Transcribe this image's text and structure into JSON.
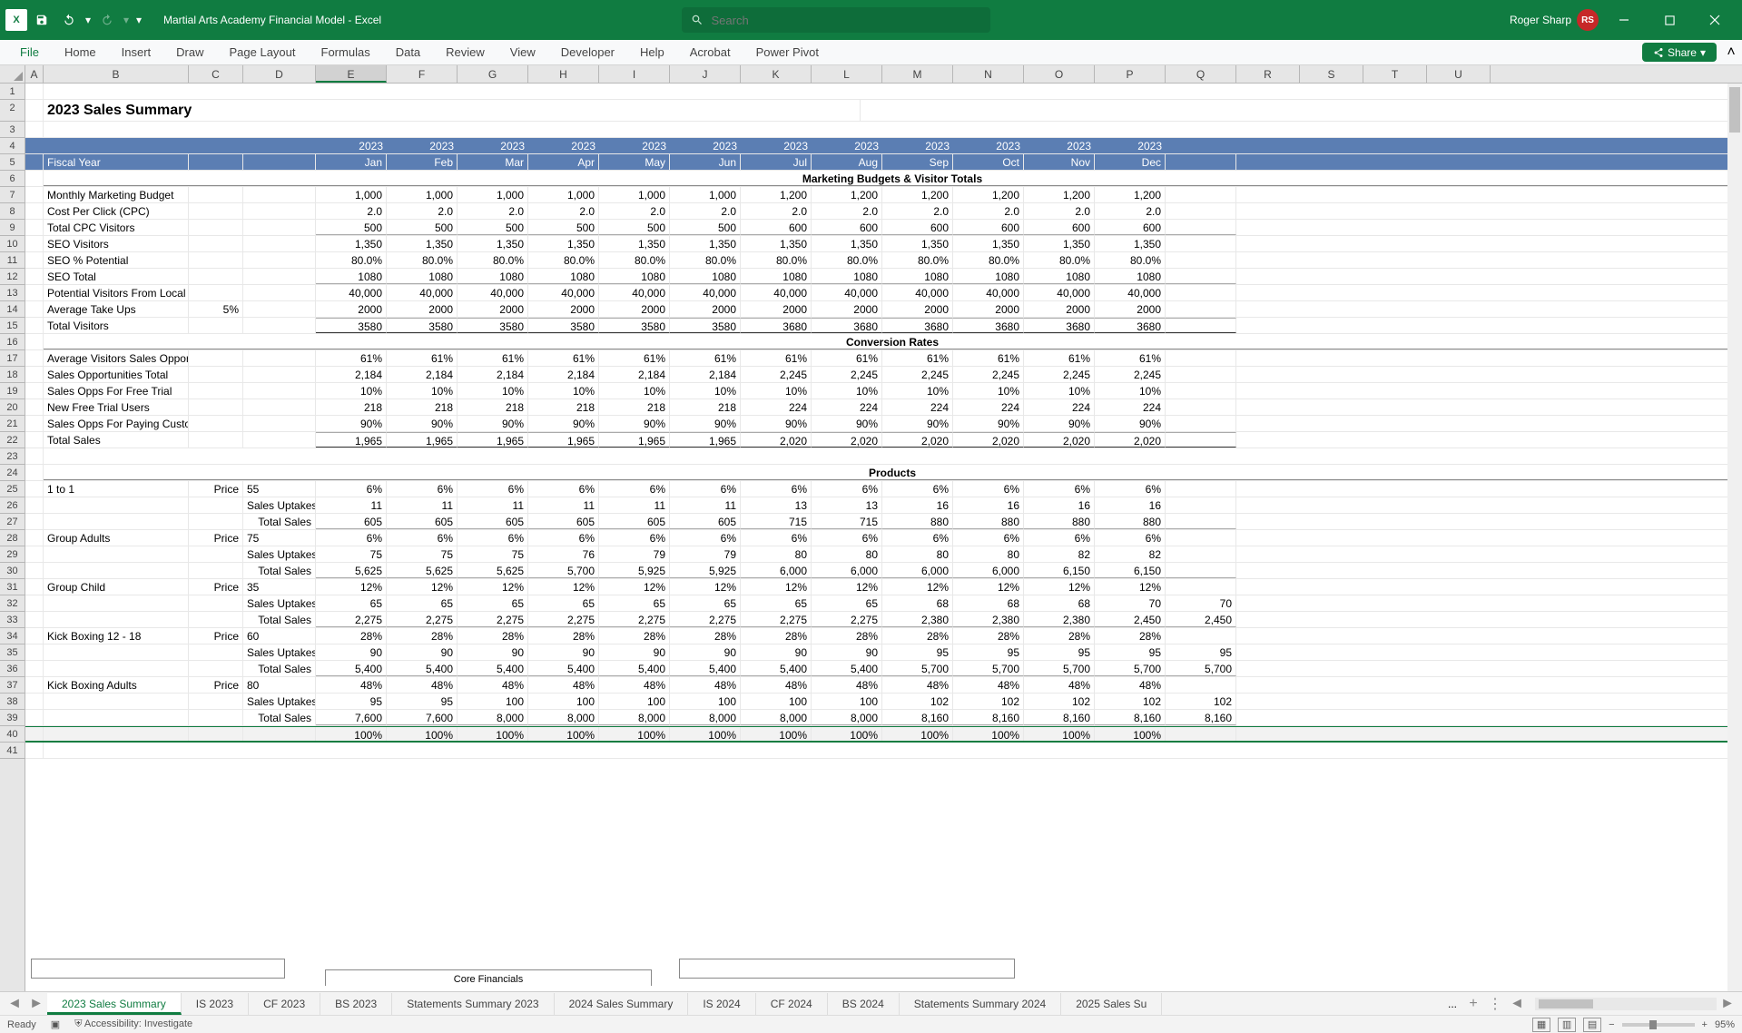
{
  "app": {
    "title": "Martial Arts Academy Financial Model  -  Excel",
    "user": "Roger Sharp",
    "initials": "RS",
    "search_placeholder": "Search"
  },
  "ribbon": [
    "File",
    "Home",
    "Insert",
    "Draw",
    "Page Layout",
    "Formulas",
    "Data",
    "Review",
    "View",
    "Developer",
    "Help",
    "Acrobat",
    "Power Pivot"
  ],
  "share_label": "Share",
  "columns": [
    "A",
    "B",
    "C",
    "D",
    "E",
    "F",
    "G",
    "H",
    "I",
    "J",
    "K",
    "L",
    "M",
    "N",
    "O",
    "P",
    "Q",
    "R",
    "S",
    "T",
    "U"
  ],
  "row_count": 41,
  "active_col": "E",
  "page_title": "2023 Sales Summary",
  "years": [
    "2023",
    "2023",
    "2023",
    "2023",
    "2023",
    "2023",
    "2023",
    "2023",
    "2023",
    "2023",
    "2023",
    "2023"
  ],
  "fiscal_year_label": "Fiscal Year",
  "months": [
    "Jan",
    "Feb",
    "Mar",
    "Apr",
    "May",
    "Jun",
    "Jul",
    "Aug",
    "Sep",
    "Oct",
    "Nov",
    "Dec"
  ],
  "sections": {
    "marketing": "Marketing Budgets & Visitor Totals",
    "conversion": "Conversion Rates",
    "products": "Products"
  },
  "rows": [
    {
      "label": "Monthly Marketing Budget",
      "vals": [
        "1,000",
        "1,000",
        "1,000",
        "1,000",
        "1,000",
        "1,000",
        "1,200",
        "1,200",
        "1,200",
        "1,200",
        "1,200",
        "1,200"
      ]
    },
    {
      "label": "Cost Per Click (CPC)",
      "vals": [
        "2.0",
        "2.0",
        "2.0",
        "2.0",
        "2.0",
        "2.0",
        "2.0",
        "2.0",
        "2.0",
        "2.0",
        "2.0",
        "2.0"
      ]
    },
    {
      "label": "Total CPC Visitors",
      "ul": true,
      "vals": [
        "500",
        "500",
        "500",
        "500",
        "500",
        "500",
        "600",
        "600",
        "600",
        "600",
        "600",
        "600"
      ]
    },
    {
      "label": "SEO Visitors",
      "vals": [
        "1,350",
        "1,350",
        "1,350",
        "1,350",
        "1,350",
        "1,350",
        "1,350",
        "1,350",
        "1,350",
        "1,350",
        "1,350",
        "1,350"
      ]
    },
    {
      "label": "SEO % Potential",
      "vals": [
        "80.0%",
        "80.0%",
        "80.0%",
        "80.0%",
        "80.0%",
        "80.0%",
        "80.0%",
        "80.0%",
        "80.0%",
        "80.0%",
        "80.0%",
        "80.0%"
      ]
    },
    {
      "label": "SEO Total",
      "ul": true,
      "vals": [
        "1080",
        "1080",
        "1080",
        "1080",
        "1080",
        "1080",
        "1080",
        "1080",
        "1080",
        "1080",
        "1080",
        "1080"
      ]
    },
    {
      "label": "Potential Visitors From Local Area",
      "vals": [
        "40,000",
        "40,000",
        "40,000",
        "40,000",
        "40,000",
        "40,000",
        "40,000",
        "40,000",
        "40,000",
        "40,000",
        "40,000",
        "40,000"
      ]
    },
    {
      "label": "Average Take Ups",
      "extra": "5%",
      "vals": [
        "2000",
        "2000",
        "2000",
        "2000",
        "2000",
        "2000",
        "2000",
        "2000",
        "2000",
        "2000",
        "2000",
        "2000"
      ]
    },
    {
      "label": "Total Visitors",
      "bul": true,
      "vals": [
        "3580",
        "3580",
        "3580",
        "3580",
        "3580",
        "3580",
        "3680",
        "3680",
        "3680",
        "3680",
        "3680",
        "3680"
      ]
    }
  ],
  "conv_rows": [
    {
      "label": "Average Visitors Sales Opportunities",
      "vals": [
        "61%",
        "61%",
        "61%",
        "61%",
        "61%",
        "61%",
        "61%",
        "61%",
        "61%",
        "61%",
        "61%",
        "61%"
      ]
    },
    {
      "label": "Sales Opportunities Total",
      "vals": [
        "2,184",
        "2,184",
        "2,184",
        "2,184",
        "2,184",
        "2,184",
        "2,245",
        "2,245",
        "2,245",
        "2,245",
        "2,245",
        "2,245"
      ]
    },
    {
      "label": "Sales Opps For Free Trial",
      "vals": [
        "10%",
        "10%",
        "10%",
        "10%",
        "10%",
        "10%",
        "10%",
        "10%",
        "10%",
        "10%",
        "10%",
        "10%"
      ]
    },
    {
      "label": "New Free Trial Users",
      "vals": [
        "218",
        "218",
        "218",
        "218",
        "218",
        "218",
        "224",
        "224",
        "224",
        "224",
        "224",
        "224"
      ]
    },
    {
      "label": "Sales Opps For Paying Customers",
      "vals": [
        "90%",
        "90%",
        "90%",
        "90%",
        "90%",
        "90%",
        "90%",
        "90%",
        "90%",
        "90%",
        "90%",
        "90%"
      ]
    },
    {
      "label": "Total Sales",
      "bul": true,
      "vals": [
        "1,965",
        "1,965",
        "1,965",
        "1,965",
        "1,965",
        "1,965",
        "2,020",
        "2,020",
        "2,020",
        "2,020",
        "2,020",
        "2,020"
      ]
    }
  ],
  "products": [
    {
      "name": "1 to 1",
      "price_label": "Price",
      "price": "55",
      "pct": [
        "6%",
        "6%",
        "6%",
        "6%",
        "6%",
        "6%",
        "6%",
        "6%",
        "6%",
        "6%",
        "6%",
        "6%"
      ],
      "uptakes_label": "Sales Uptakes",
      "uptakes": [
        "11",
        "11",
        "11",
        "11",
        "11",
        "11",
        "13",
        "13",
        "16",
        "16",
        "16",
        "16"
      ],
      "totals_label": "Total Sales",
      "totals": [
        "605",
        "605",
        "605",
        "605",
        "605",
        "605",
        "715",
        "715",
        "880",
        "880",
        "880",
        "880"
      ]
    },
    {
      "name": "Group Adults",
      "price_label": "Price",
      "price": "75",
      "pct": [
        "6%",
        "6%",
        "6%",
        "6%",
        "6%",
        "6%",
        "6%",
        "6%",
        "6%",
        "6%",
        "6%",
        "6%"
      ],
      "uptakes_label": "Sales Uptakes",
      "uptakes": [
        "75",
        "75",
        "75",
        "76",
        "79",
        "79",
        "80",
        "80",
        "80",
        "80",
        "82",
        "82"
      ],
      "totals_label": "Total Sales",
      "totals": [
        "5,625",
        "5,625",
        "5,625",
        "5,700",
        "5,925",
        "5,925",
        "6,000",
        "6,000",
        "6,000",
        "6,000",
        "6,150",
        "6,150"
      ]
    },
    {
      "name": "Group Child",
      "price_label": "Price",
      "price": "35",
      "pct": [
        "12%",
        "12%",
        "12%",
        "12%",
        "12%",
        "12%",
        "12%",
        "12%",
        "12%",
        "12%",
        "12%",
        "12%"
      ],
      "uptakes_label": "Sales Uptakes",
      "uptakes": [
        "65",
        "65",
        "65",
        "65",
        "65",
        "65",
        "65",
        "65",
        "68",
        "68",
        "68",
        "70",
        "70"
      ],
      "totals_label": "Total Sales",
      "totals": [
        "2,275",
        "2,275",
        "2,275",
        "2,275",
        "2,275",
        "2,275",
        "2,275",
        "2,275",
        "2,380",
        "2,380",
        "2,380",
        "2,450",
        "2,450"
      ]
    },
    {
      "name": "Kick Boxing 12 - 18",
      "price_label": "Price",
      "price": "60",
      "pct": [
        "28%",
        "28%",
        "28%",
        "28%",
        "28%",
        "28%",
        "28%",
        "28%",
        "28%",
        "28%",
        "28%",
        "28%"
      ],
      "uptakes_label": "Sales Uptakes",
      "uptakes": [
        "90",
        "90",
        "90",
        "90",
        "90",
        "90",
        "90",
        "90",
        "95",
        "95",
        "95",
        "95",
        "95"
      ],
      "totals_label": "Total Sales",
      "totals": [
        "5,400",
        "5,400",
        "5,400",
        "5,400",
        "5,400",
        "5,400",
        "5,400",
        "5,400",
        "5,700",
        "5,700",
        "5,700",
        "5,700",
        "5,700"
      ]
    },
    {
      "name": "Kick Boxing Adults",
      "price_label": "Price",
      "price": "80",
      "pct": [
        "48%",
        "48%",
        "48%",
        "48%",
        "48%",
        "48%",
        "48%",
        "48%",
        "48%",
        "48%",
        "48%",
        "48%"
      ],
      "uptakes_label": "Sales Uptakes",
      "uptakes": [
        "95",
        "95",
        "100",
        "100",
        "100",
        "100",
        "100",
        "100",
        "102",
        "102",
        "102",
        "102",
        "102"
      ],
      "totals_label": "Total Sales",
      "totals": [
        "7,600",
        "7,600",
        "8,000",
        "8,000",
        "8,000",
        "8,000",
        "8,000",
        "8,000",
        "8,160",
        "8,160",
        "8,160",
        "8,160",
        "8,160"
      ]
    }
  ],
  "pct_row": [
    "100%",
    "100%",
    "100%",
    "100%",
    "100%",
    "100%",
    "100%",
    "100%",
    "100%",
    "100%",
    "100%",
    "100%"
  ],
  "float_boxes": {
    "core": "Core Financials"
  },
  "sheets": {
    "active": "2023 Sales Summary",
    "list": [
      "2023 Sales Summary",
      "IS 2023",
      "CF 2023",
      "BS 2023",
      "Statements Summary 2023",
      "2024 Sales Summary",
      "IS 2024",
      "CF 2024",
      "BS 2024",
      "Statements Summary 2024",
      "2025 Sales Su"
    ],
    "ellipsis": "..."
  },
  "status": {
    "ready": "Ready",
    "access": "Accessibility: Investigate",
    "zoom": "95%"
  }
}
